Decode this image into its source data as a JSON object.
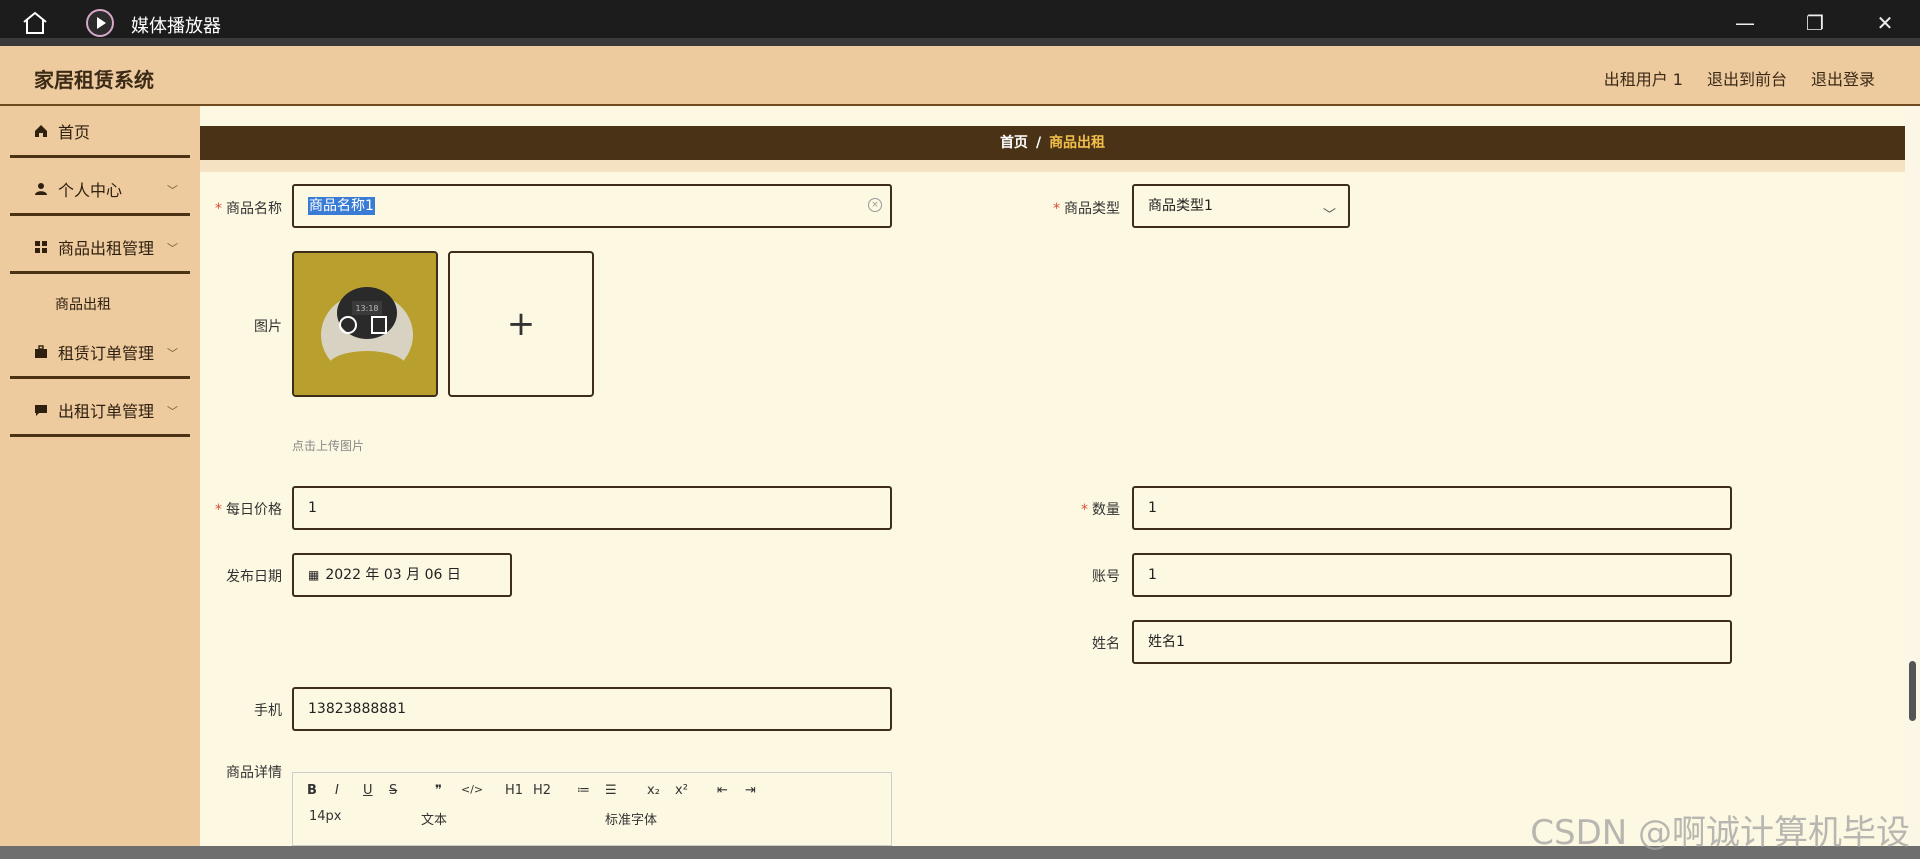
{
  "window": {
    "title": "媒体播放器",
    "controls": {
      "minimize": "—",
      "maximize": "❐",
      "close": "✕"
    }
  },
  "header": {
    "brand": "家居租赁系统",
    "links": [
      "出租用户 1",
      "退出到前台",
      "退出登录"
    ]
  },
  "sidebar": {
    "items": [
      {
        "label": "首页",
        "icon": "home-icon"
      },
      {
        "label": "个人中心",
        "icon": "user-icon"
      },
      {
        "label": "商品出租管理",
        "icon": "grid-icon"
      },
      {
        "label": "租赁订单管理",
        "icon": "briefcase-icon"
      },
      {
        "label": "出租订单管理",
        "icon": "chat-icon"
      }
    ],
    "sub_item": "商品出租"
  },
  "breadcrumb": {
    "home": "首页",
    "sep": "/",
    "current": "商品出租"
  },
  "form": {
    "name_label": "商品名称",
    "name_value": "商品名称1",
    "type_label": "商品类型",
    "type_value": "商品类型1",
    "image_label": "图片",
    "upload_hint": "点击上传图片",
    "plus_symbol": "+",
    "price_label": "每日价格",
    "price_value": "1",
    "qty_label": "数量",
    "qty_value": "1",
    "date_label": "发布日期",
    "date_value": "2022 年 03 月 06 日",
    "account_label": "账号",
    "account_value": "1",
    "fullname_label": "姓名",
    "fullname_value": "姓名1",
    "phone_label": "手机",
    "phone_value": "13823888881",
    "detail_label": "商品详情",
    "required_mark": "*"
  },
  "editor": {
    "row1": [
      "B",
      "I",
      "U",
      "S",
      "❞",
      "</>",
      "H1",
      "H2",
      "≔",
      "☰",
      "x₂",
      "x²",
      "⇤",
      "⇥"
    ],
    "font_size": "14px",
    "text_format": "文本",
    "font_family": "标准字体"
  },
  "watermark": "CSDN @啊诚计算机毕设",
  "colors": {
    "sidebar_bg": "#edcb9f",
    "breadcrumb_bg": "#4a3216",
    "accent": "#f2c04a",
    "page_bg": "#fdf8e2"
  }
}
